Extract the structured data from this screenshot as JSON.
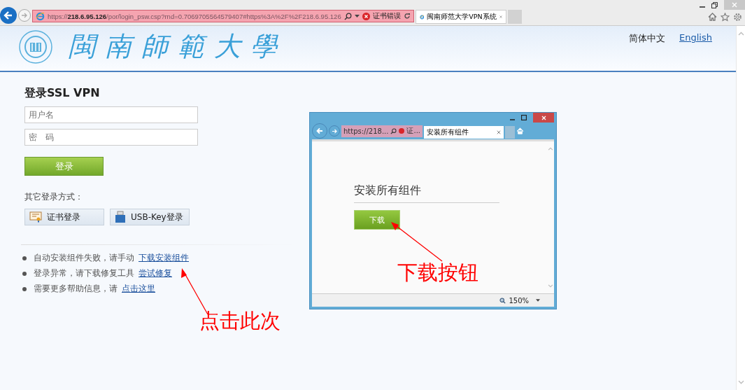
{
  "browser": {
    "url": "https://**218.6.95.126**/por/login_psw.csp?rnd=0.7069705564579407#https%3A%2F%2F218.6.95.126",
    "cert_error": "证书错误",
    "tabs": [
      {
        "title": "闽南师范大学VPN系统",
        "selected": true
      }
    ]
  },
  "header": {
    "logo_text": "閩南師範大學",
    "languages": [
      {
        "label": "简体中文",
        "selected": true
      },
      {
        "label": "English",
        "selected": false
      }
    ]
  },
  "login": {
    "title": "登录SSL VPN",
    "username": {
      "placeholder": "用户名"
    },
    "password": {
      "placeholder": "密　码"
    },
    "submit": "登录",
    "other_label": "其它登录方式：",
    "alt_buttons": [
      {
        "kind": "cert",
        "label": "证书登录"
      },
      {
        "kind": "usb",
        "label": "USB-Key登录"
      }
    ],
    "help": [
      {
        "text": "自动安装组件失败，请手动",
        "link": "下载安装组件"
      },
      {
        "text": "登录异常，请下载修复工具",
        "link": "尝试修复"
      },
      {
        "text": "需要更多帮助信息，请",
        "link": "点击这里"
      }
    ]
  },
  "inset": {
    "url": "https://218...",
    "cert_error": "证...",
    "tab": "安装所有组件",
    "heading": "安装所有组件",
    "button": "下载",
    "zoom": "150%"
  },
  "annotations": [
    {
      "text": "点击此次"
    },
    {
      "text": "下载按钮"
    }
  ]
}
